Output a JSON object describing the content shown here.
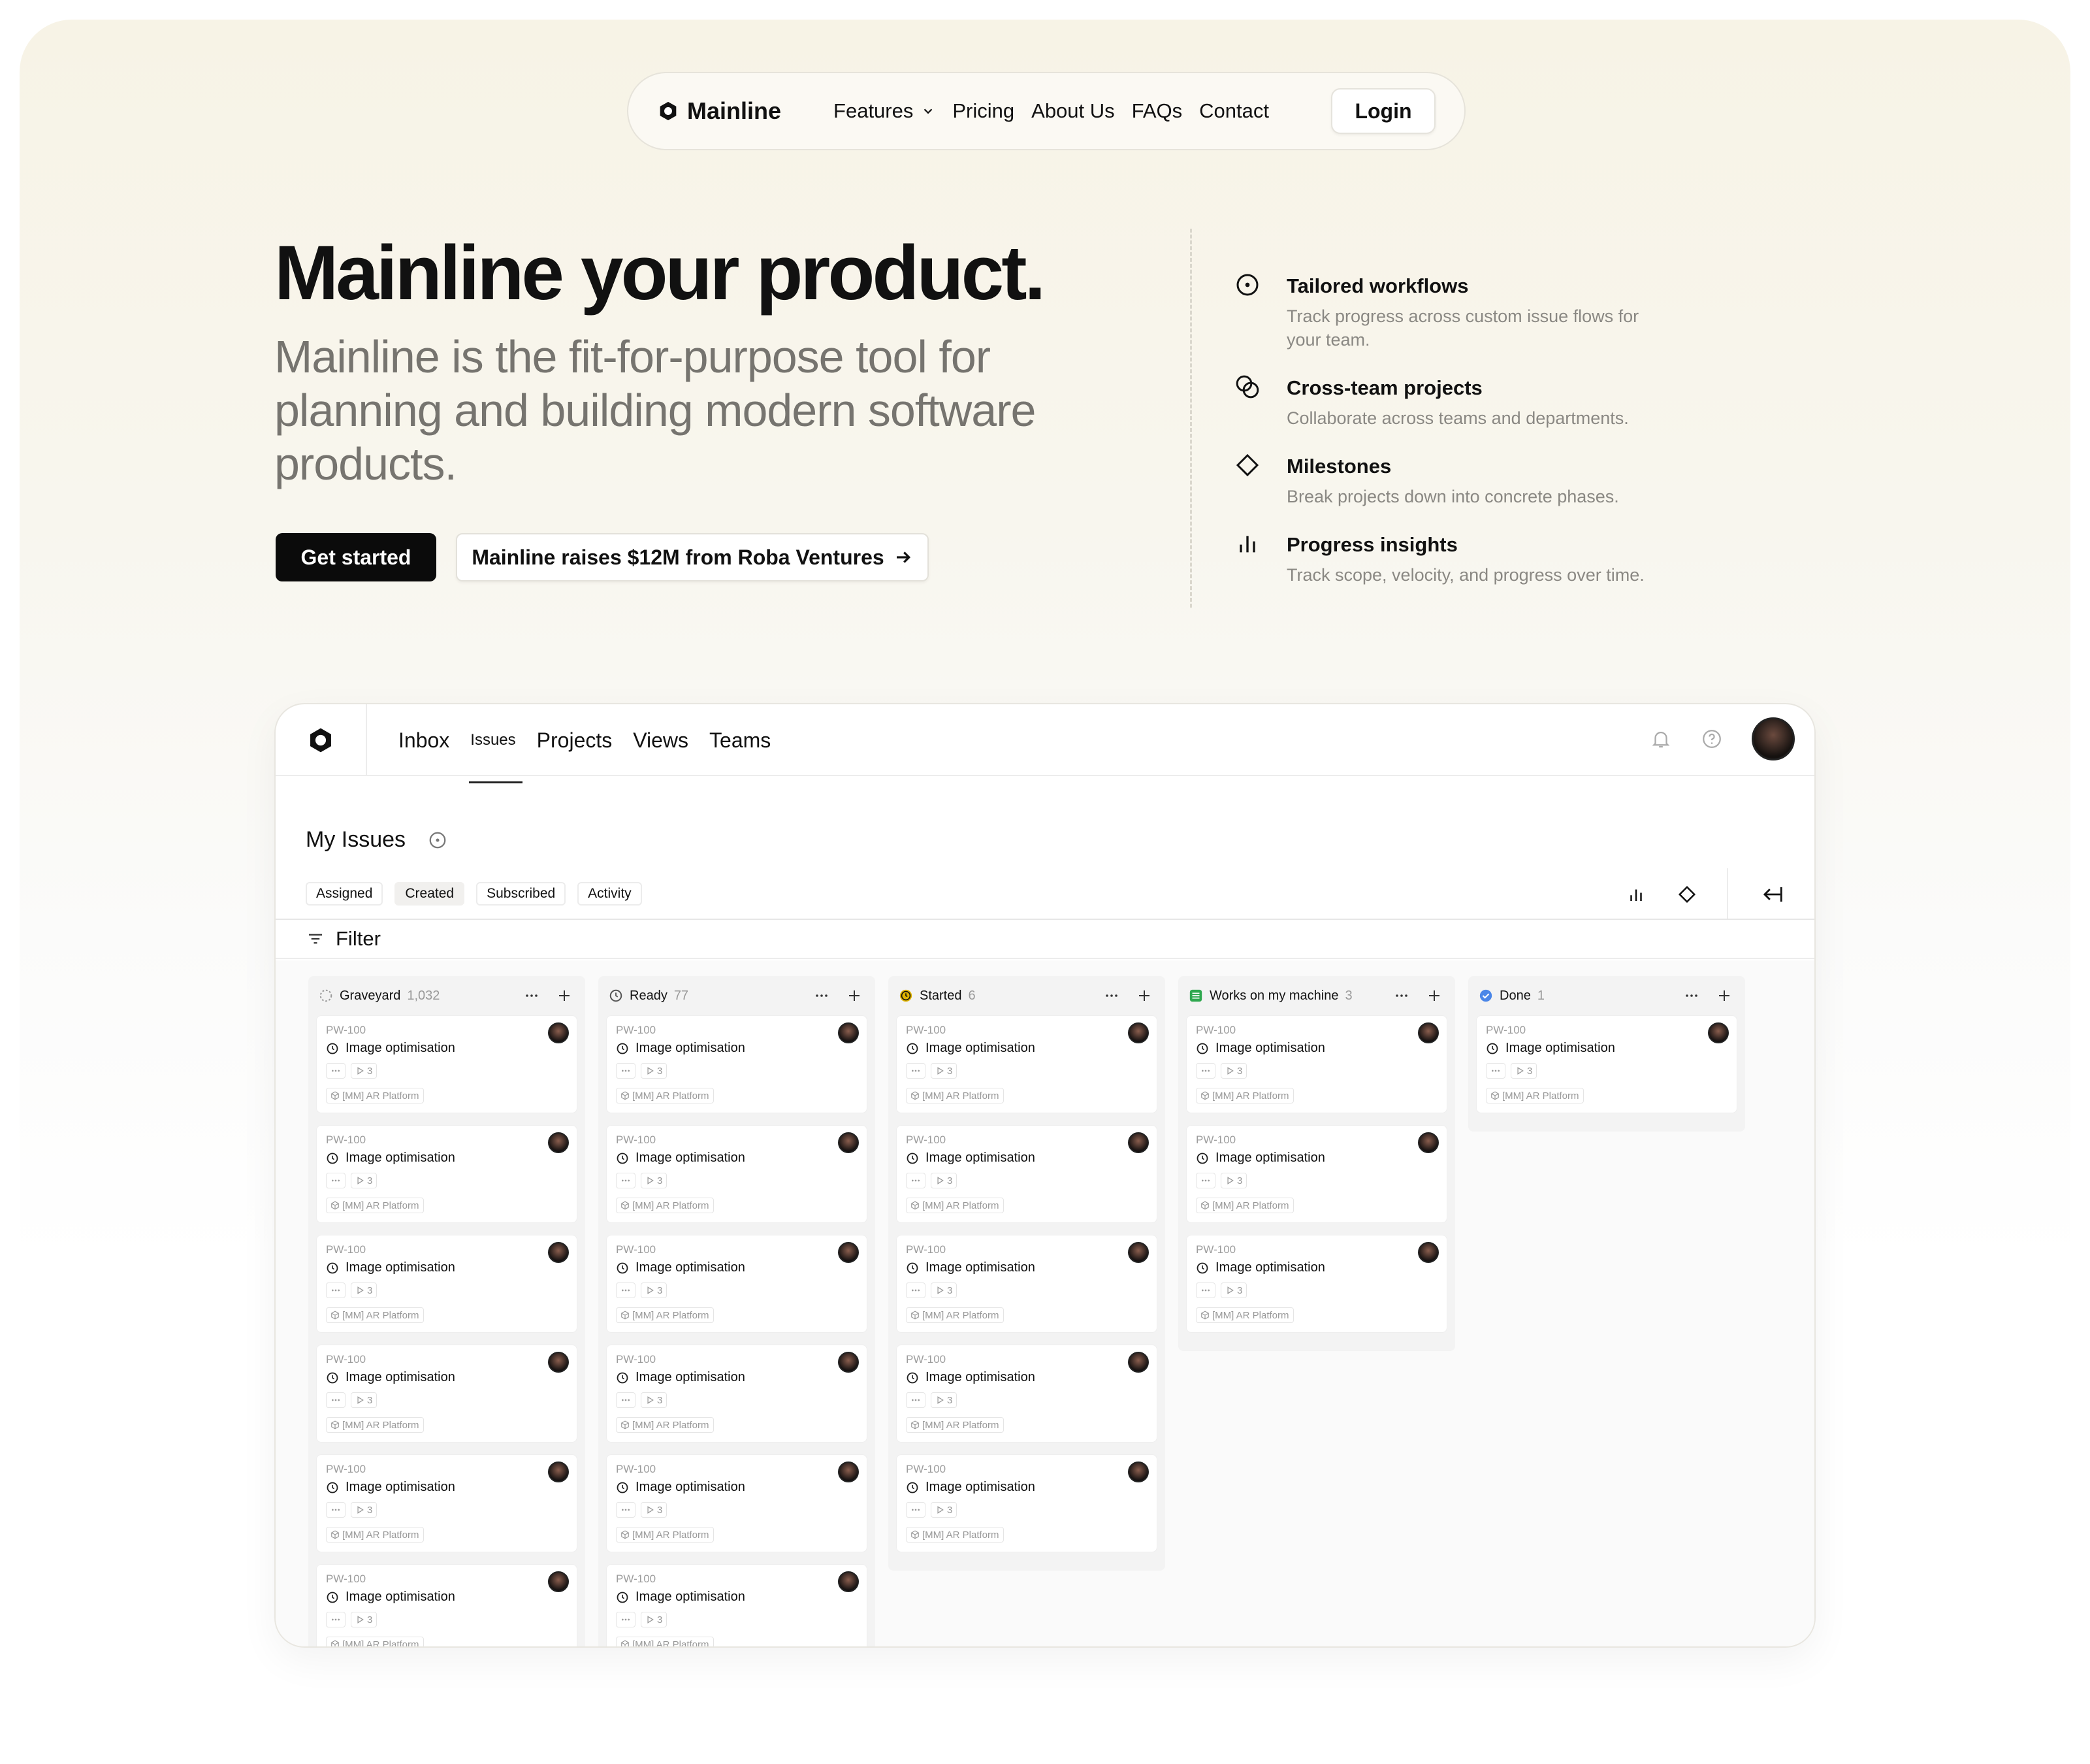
{
  "nav": {
    "brand": "Mainline",
    "links": [
      "Features",
      "Pricing",
      "About Us",
      "FAQs",
      "Contact"
    ],
    "login": "Login"
  },
  "hero": {
    "title": "Mainline your product.",
    "subtitle": "Mainline is the fit-for-purpose tool for planning and building modern software products.",
    "cta_primary": "Get started",
    "cta_news": "Mainline raises $12M from Roba Ventures"
  },
  "features": [
    {
      "icon": "circle-dot-icon",
      "title": "Tailored workflows",
      "desc": "Track progress across custom issue flows for your team."
    },
    {
      "icon": "overlap-circles-icon",
      "title": "Cross-team projects",
      "desc": "Collaborate across teams and departments."
    },
    {
      "icon": "diamond-icon",
      "title": "Milestones",
      "desc": "Break projects down into concrete phases."
    },
    {
      "icon": "bar-chart-icon",
      "title": "Progress insights",
      "desc": "Track scope, velocity, and progress over time."
    }
  ],
  "app": {
    "tabs": [
      "Inbox",
      "Issues",
      "Projects",
      "Views",
      "Teams"
    ],
    "page_title": "My Issues",
    "subtabs": [
      "Assigned",
      "Created",
      "Subscribed",
      "Activity"
    ],
    "active_subtab": "Created",
    "filter_label": "Filter",
    "card": {
      "id": "PW-100",
      "title": "Image optimisation",
      "sub_count": "3",
      "project": "[MM] AR Platform"
    },
    "columns": [
      {
        "name": "Graveyard",
        "count": "1,032",
        "status_color": "#9a9a9a",
        "cards": 6
      },
      {
        "name": "Ready",
        "count": "77",
        "status_color": "#555555",
        "cards": 6
      },
      {
        "name": "Started",
        "count": "6",
        "status_color": "#e0b400",
        "cards": 5
      },
      {
        "name": "Works on my machine",
        "count": "3",
        "status_color": "#2fa84f",
        "cards": 3
      },
      {
        "name": "Done",
        "count": "1",
        "status_color": "#4a86e8",
        "cards": 1
      }
    ]
  }
}
